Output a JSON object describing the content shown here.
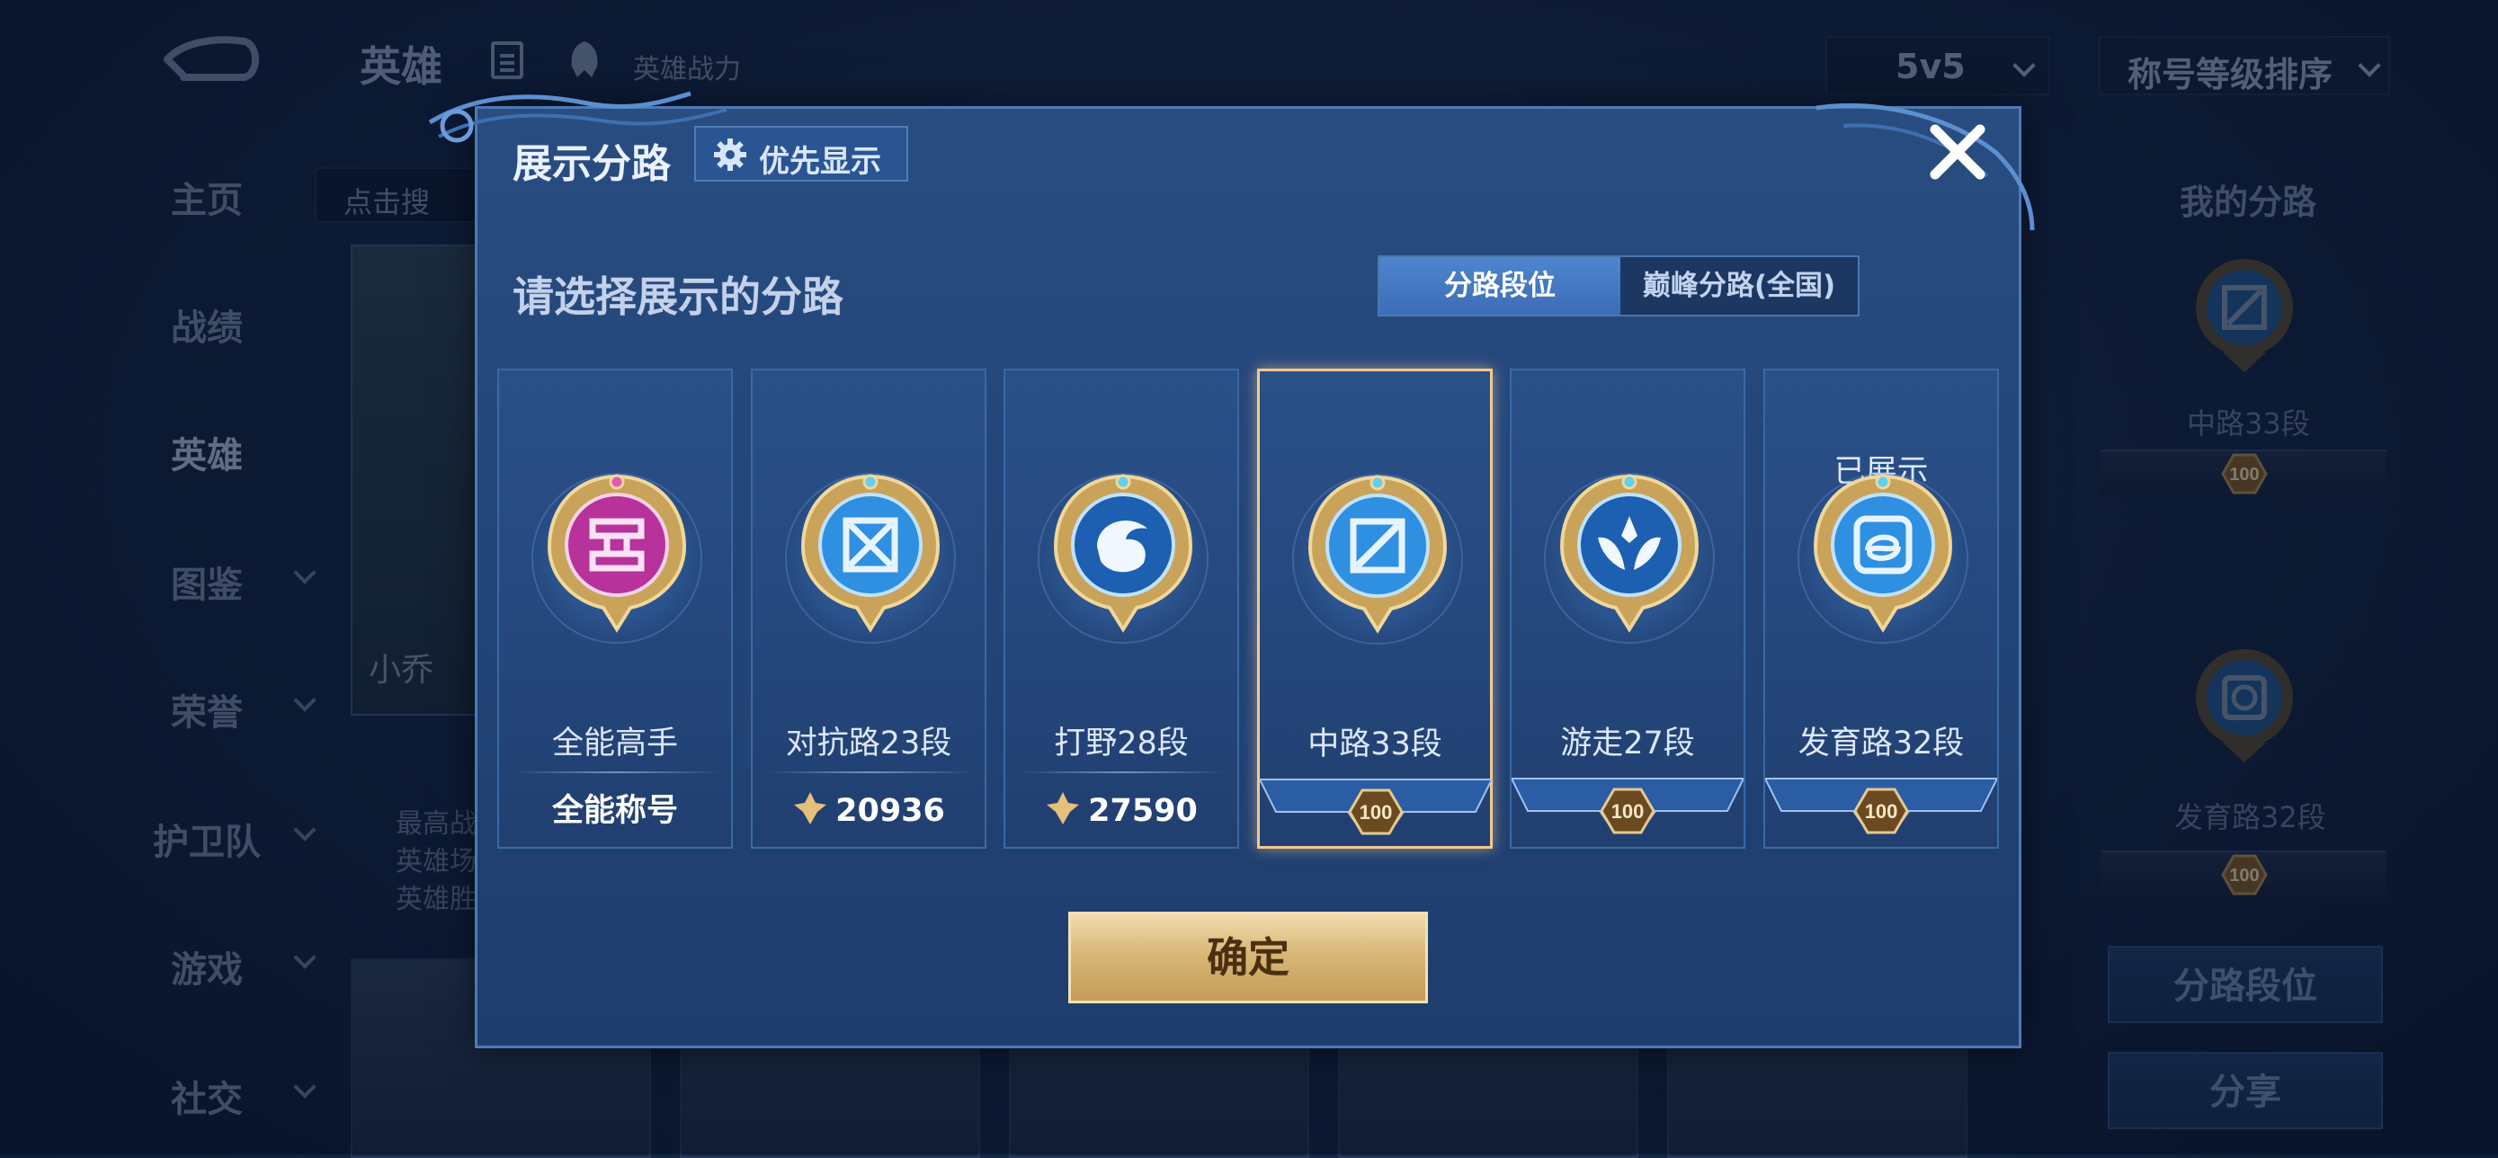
{
  "topbar": {
    "title": "英雄",
    "power_link": "英雄战力",
    "mode_value": "5v5",
    "sort_value": "称号等级排序"
  },
  "sidebar": {
    "items": [
      {
        "label": "主页",
        "active": false,
        "has_chevron": false
      },
      {
        "label": "战绩",
        "active": false,
        "has_chevron": false
      },
      {
        "label": "英雄",
        "active": true,
        "has_chevron": false
      },
      {
        "label": "图鉴",
        "active": false,
        "has_chevron": true
      },
      {
        "label": "荣誉",
        "active": false,
        "has_chevron": true
      },
      {
        "label": "护卫队",
        "active": false,
        "has_chevron": true
      },
      {
        "label": "游戏",
        "active": false,
        "has_chevron": true
      },
      {
        "label": "社交",
        "active": false,
        "has_chevron": true
      }
    ]
  },
  "background": {
    "search_placeholder": "点击搜",
    "hero_name": "小乔",
    "stat_lines": [
      "最高战",
      "英雄场",
      "英雄胜"
    ]
  },
  "right_panel": {
    "title": "我的分路",
    "lane1_label": "中路33段",
    "lane1_rank": "100",
    "lane2_label": "发育路32段",
    "lane2_rank": "100",
    "btn_lane_rank": "分路段位",
    "btn_share": "分享"
  },
  "modal": {
    "title": "展示分路",
    "priority_label": "优先显示",
    "subtitle": "请选择展示的分路",
    "tab_active": "分路段位",
    "tab_inactive": "巅峰分路(全国)",
    "confirm": "确定",
    "lanes": [
      {
        "name": "全能高手",
        "footer": "全能称号",
        "footer_type": "text",
        "badge": "all-round-badge-icon",
        "badge_color": "#b7329a"
      },
      {
        "name": "对抗路23段",
        "footer": "20936",
        "footer_type": "points",
        "badge": "clash-lane-badge-icon",
        "badge_color": "#2f8fe0"
      },
      {
        "name": "打野28段",
        "footer": "27590",
        "footer_type": "points",
        "badge": "jungle-badge-icon",
        "badge_color": "#2f7fd8"
      },
      {
        "name": "中路33段",
        "footer": "100",
        "footer_type": "rank",
        "badge": "mid-lane-badge-icon",
        "badge_color": "#2f8fe0",
        "selected": true
      },
      {
        "name": "游走27段",
        "footer": "100",
        "footer_type": "rank",
        "badge": "roam-badge-icon",
        "badge_color": "#2f7fd8"
      },
      {
        "name": "发育路32段",
        "footer": "100",
        "footer_type": "rank",
        "badge": "farm-lane-badge-icon",
        "badge_color": "#2f8fe0",
        "shown_label": "已展示"
      }
    ]
  },
  "colors": {
    "modal_bg": "#24467a",
    "accent_gold": "#d9b878",
    "selected_border": "#f1c98e",
    "tab_active": "#3f73bb"
  }
}
